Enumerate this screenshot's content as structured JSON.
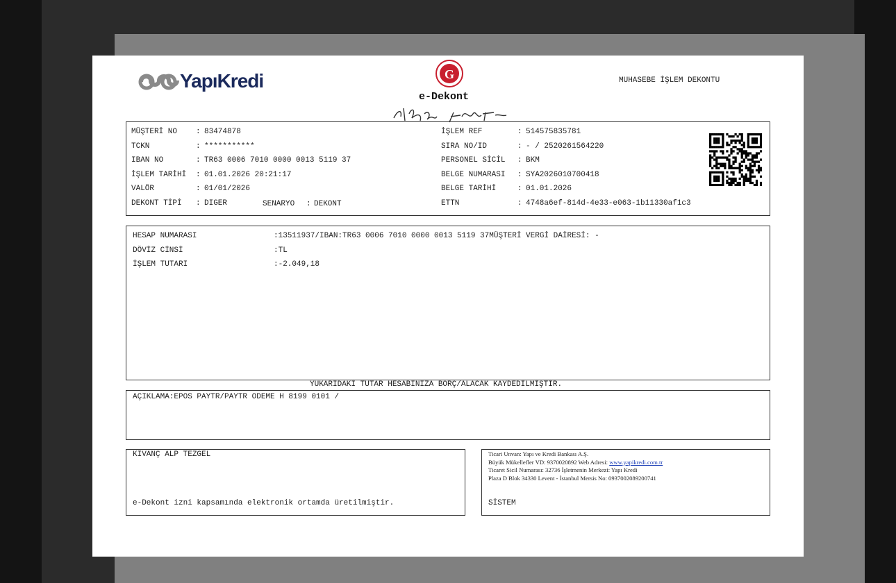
{
  "header": {
    "brand": "YapıKredi",
    "logo_caption": "e-Dekont",
    "doc_title": "MUHASEBE İŞLEM DEKONTU"
  },
  "info": {
    "left": [
      {
        "label": "MÜŞTERİ NO",
        "value": "83474878"
      },
      {
        "label": "TCKN",
        "value": "***********"
      },
      {
        "label": "IBAN NO",
        "value": "TR63 0006 7010 0000 0013 5119 37"
      },
      {
        "label": "İŞLEM TARİHİ",
        "value": "01.01.2026 20:21:17"
      },
      {
        "label": "VALÖR",
        "value": "01/01/2026"
      },
      {
        "label": "DEKONT TİPİ",
        "value": "DIGER"
      }
    ],
    "scenario": {
      "label": "SENARYO",
      "value": "DEKONT"
    },
    "right": [
      {
        "label": "İŞLEM REF",
        "value": "514575835781"
      },
      {
        "label": "SIRA NO/ID",
        "value": "- / 2520261564220"
      },
      {
        "label": "PERSONEL SİCİL",
        "value": "BKM"
      },
      {
        "label": "BELGE NUMARASI",
        "value": "SYA2026010700418"
      },
      {
        "label": "BELGE TARİHİ",
        "value": "01.01.2026"
      },
      {
        "label": "ETTN",
        "value": "4748a6ef-814d-4e33-e063-1b11330af1c3"
      }
    ]
  },
  "account": {
    "rows": [
      {
        "label": "HESAP NUMARASI",
        "value": ":13511937/IBAN:TR63 0006 7010 0000 0013 5119 37MÜŞTERİ VERGİ DAİRESİ: -"
      },
      {
        "label": "DÖVİZ CİNSİ",
        "value": ":TL"
      },
      {
        "label": "İŞLEM TUTARI",
        "value": ":-2.049,18"
      }
    ]
  },
  "notice": "YUKARIDAKİ TUTAR HESABINIZA BORÇ/ALACAK KAYDEDİLMİŞTİR.",
  "description": "AÇIKLAMA:EPOS PAYTR/PAYTR ODEME H 8199 0101 /",
  "footer_left": {
    "name": "KIVANÇ ALP TEZGEL",
    "note": "e-Dekont izni kapsamında elektronik ortamda üretilmiştir."
  },
  "footer_right": {
    "line1": "Ticari Unvan: Yapı ve Kredi Bankası A.Ş.",
    "line2_prefix": "Büyük Mükellefler VD: 9370020892 Web Adresi: ",
    "line2_link": "www.yapikredi.com.tr",
    "line3": "Ticaret Sicil Numarası: 32736 İşletmenin Merkezi: Yapı Kredi",
    "line4": "Plaza D Blok 34330 Levent - İstanbul Mersis No: 0937002089200741",
    "signer": "SİSTEM"
  },
  "colors": {
    "brand_navy": "#1b2a5c",
    "logo_gray": "#8a8a8a",
    "seal_red": "#c8202f",
    "link_blue": "#1a3db5"
  }
}
